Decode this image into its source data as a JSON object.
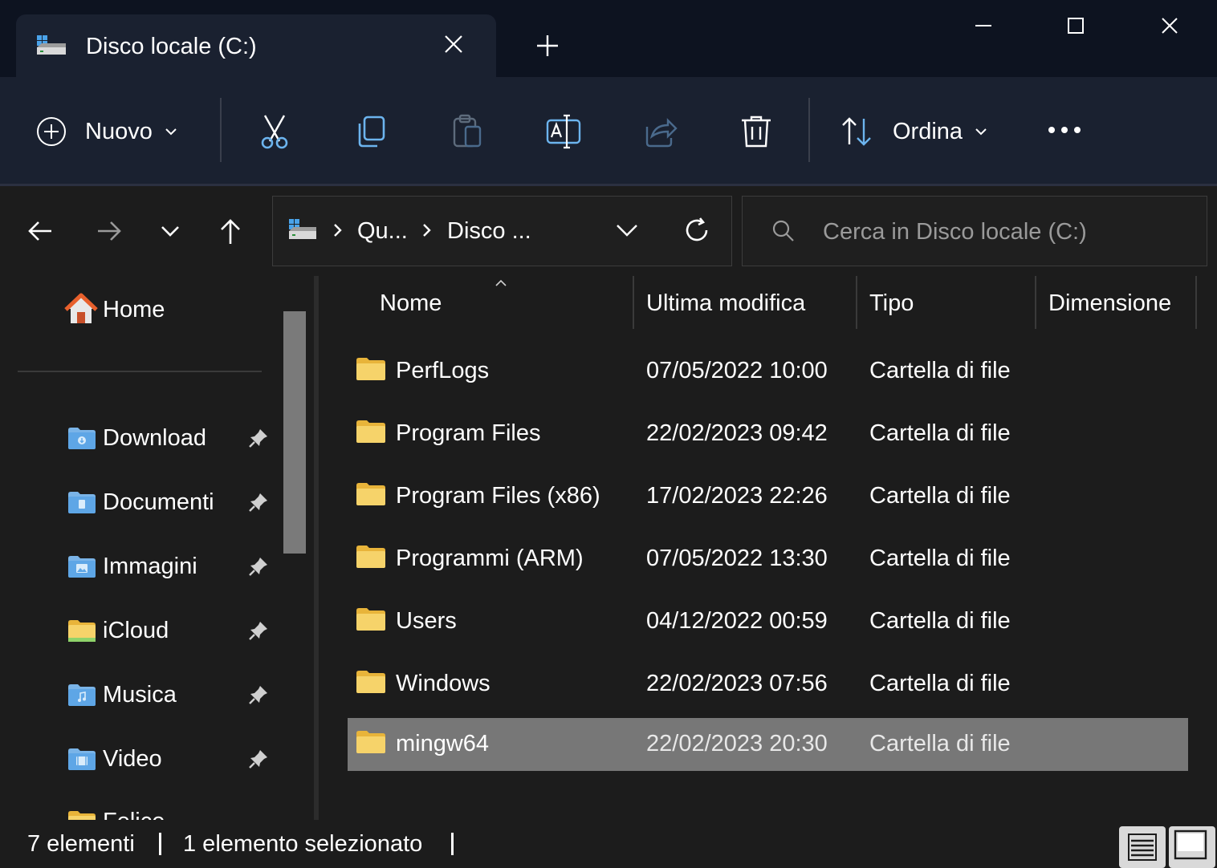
{
  "window": {
    "tab_title": "Disco locale (C:)",
    "tab_icon": "drive-icon",
    "controls": [
      "minimize-icon",
      "maximize-icon",
      "close-icon"
    ]
  },
  "toolbar": {
    "new_label": "Nuovo",
    "sort_label": "Ordina",
    "actions": [
      "cut-icon",
      "copy-icon",
      "paste-icon",
      "rename-icon",
      "share-icon",
      "delete-icon"
    ]
  },
  "address": {
    "crumbs": [
      "Qu...",
      "Disco ..."
    ]
  },
  "search": {
    "placeholder": "Cerca in Disco locale (C:)"
  },
  "sidebar": {
    "home_label": "Home",
    "items": [
      {
        "label": "Download",
        "icon": "download-folder-icon",
        "pinned": true
      },
      {
        "label": "Documenti",
        "icon": "documents-folder-icon",
        "pinned": true
      },
      {
        "label": "Immagini",
        "icon": "pictures-folder-icon",
        "pinned": true
      },
      {
        "label": "iCloud",
        "icon": "icloud-folder-icon",
        "pinned": true
      },
      {
        "label": "Musica",
        "icon": "music-folder-icon",
        "pinned": true
      },
      {
        "label": "Video",
        "icon": "video-folder-icon",
        "pinned": true
      },
      {
        "label": "Felice",
        "icon": "folder-icon",
        "pinned": false
      }
    ]
  },
  "columns": {
    "name": "Nome",
    "modified": "Ultima modifica",
    "type": "Tipo",
    "size": "Dimensione"
  },
  "files": [
    {
      "name": "PerfLogs",
      "modified": "07/05/2022 10:00",
      "type": "Cartella di file",
      "selected": false
    },
    {
      "name": "Program Files",
      "modified": "22/02/2023 09:42",
      "type": "Cartella di file",
      "selected": false
    },
    {
      "name": "Program Files (x86)",
      "modified": "17/02/2023 22:26",
      "type": "Cartella di file",
      "selected": false
    },
    {
      "name": "Programmi (ARM)",
      "modified": "07/05/2022 13:30",
      "type": "Cartella di file",
      "selected": false
    },
    {
      "name": "Users",
      "modified": "04/12/2022 00:59",
      "type": "Cartella di file",
      "selected": false
    },
    {
      "name": "Windows",
      "modified": "22/02/2023 07:56",
      "type": "Cartella di file",
      "selected": false
    },
    {
      "name": "mingw64",
      "modified": "22/02/2023 20:30",
      "type": "Cartella di file",
      "selected": true
    }
  ],
  "status": {
    "count": "7 elementi",
    "selection": "1 elemento selezionato"
  },
  "colors": {
    "titlebar": "#0d1320",
    "toolbar": "#1a2130",
    "background": "#1c1c1c",
    "selected_row": "#777777",
    "folder_yellow": "#f4c84a",
    "accent_blue": "#6cb4ee"
  }
}
